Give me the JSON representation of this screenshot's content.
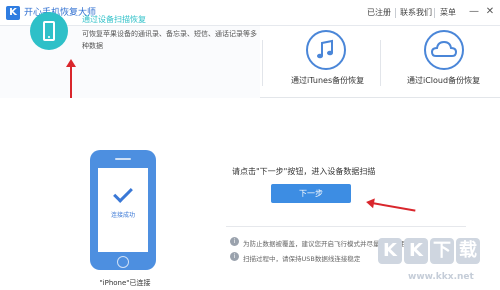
{
  "window": {
    "logo_letter": "K",
    "title": "开心手机恢复大师",
    "links": [
      "已注册",
      "联系我们",
      "菜单"
    ],
    "controls": [
      "—",
      "✕"
    ]
  },
  "modes": [
    {
      "title": "通过设备扫描恢复",
      "description": "可恢复苹果设备的通讯录、备忘录、短信、通话记录等多种数据",
      "icon": "phone-icon",
      "active": true
    },
    {
      "title": "通过iTunes备份恢复",
      "icon": "music-note-icon",
      "active": false
    },
    {
      "title": "通过iCloud备份恢复",
      "icon": "cloud-icon",
      "active": false
    }
  ],
  "device": {
    "status": "连接成功",
    "name": "\"iPhone\"已连接"
  },
  "main": {
    "prompt": "请点击\"下一步\"按钮，进入设备数据扫描",
    "next_button": "下一步",
    "tips": [
      "为防止数据被覆盖，建议您开启飞行模式并尽量停止使用手机",
      "扫描过程中，请保持USB数据线连接稳定"
    ]
  },
  "watermark": {
    "letters": [
      "K",
      "K",
      "下",
      "载"
    ],
    "url": "www.kkx.net"
  },
  "colors": {
    "accent": "#2ec0c8",
    "brand_blue": "#3d8de3",
    "annotation_red": "#d9262c"
  }
}
